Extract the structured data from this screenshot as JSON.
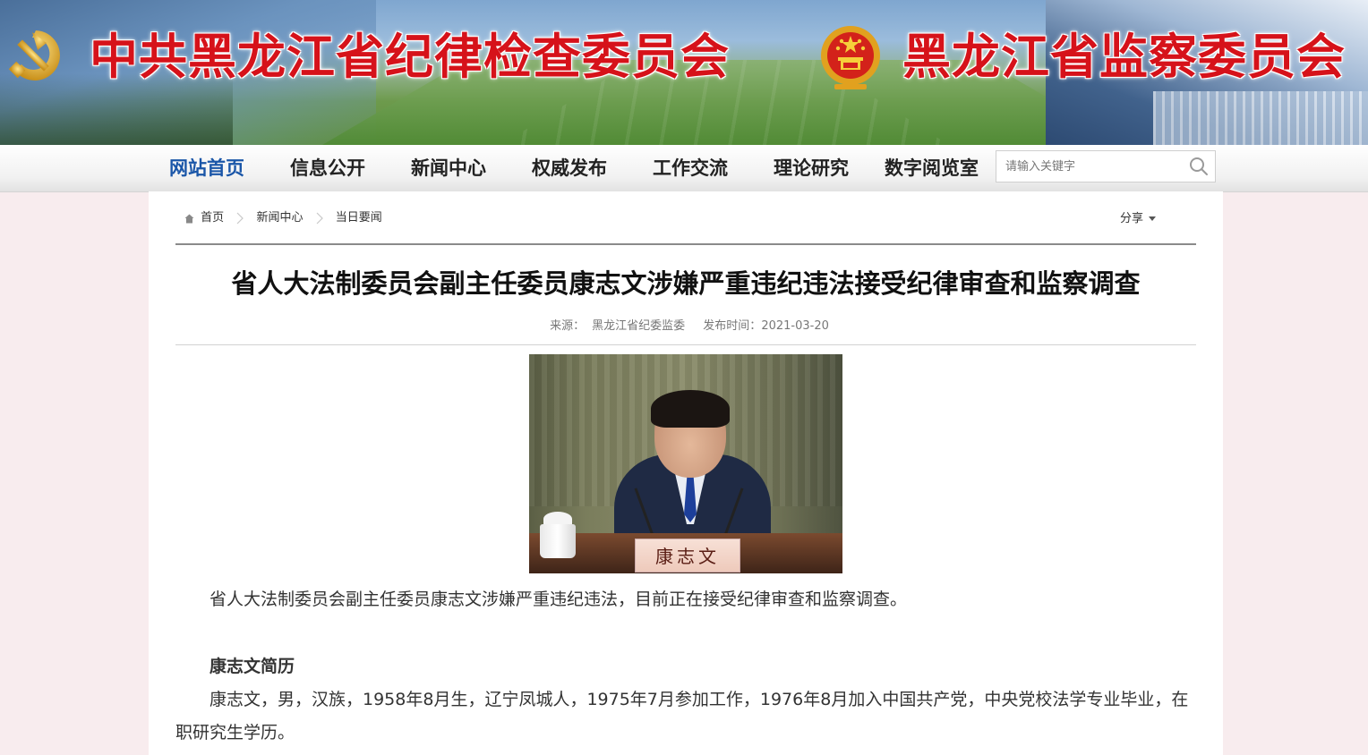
{
  "banner": {
    "title_left": "中共黑龙江省纪律检查委员会",
    "title_right": "黑龙江省监察委员会"
  },
  "nav": {
    "items": [
      {
        "label": "网站首页",
        "active": true
      },
      {
        "label": "信息公开"
      },
      {
        "label": "新闻中心"
      },
      {
        "label": "权威发布"
      },
      {
        "label": "工作交流"
      },
      {
        "label": "理论研究"
      },
      {
        "label": "数字阅览室"
      }
    ],
    "search_placeholder": "请输入关键字"
  },
  "breadcrumb": [
    "首页",
    "新闻中心",
    "当日要闻"
  ],
  "share_label": "分享",
  "article": {
    "title": "省人大法制委员会副主任委员康志文涉嫌严重违纪违法接受纪律审查和监察调查",
    "source_label": "来源：",
    "source": "黑龙江省纪委监委",
    "date_label": "发布时间：",
    "date": "2021-03-20",
    "photo_nameplate": "康志文",
    "paragraphs": [
      "省人大法制委员会副主任委员康志文涉嫌严重违纪违法，目前正在接受纪律审查和监察调查。",
      "康志文简历",
      "康志文，男，汉族，1958年8月生，辽宁凤城人，1975年7月参加工作，1976年8月加入中国共产党，中央党校法学专业毕业，在职研究生学历。"
    ]
  },
  "colors": {
    "banner_title": "#d6121a",
    "nav_active": "#1a56a8",
    "page_bg": "#f8ecee"
  }
}
